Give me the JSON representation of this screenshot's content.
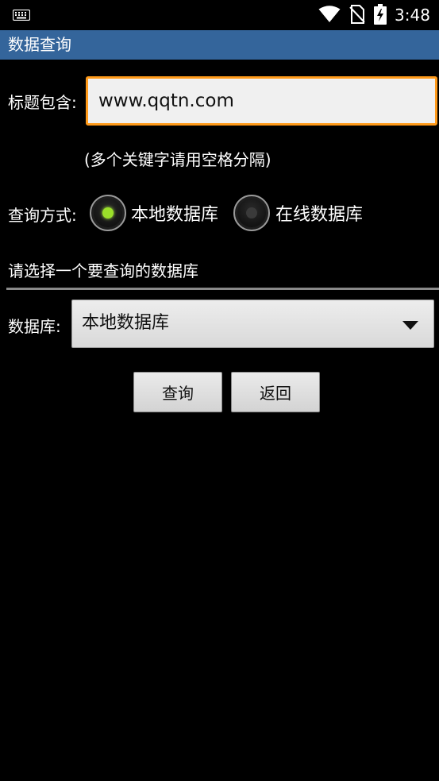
{
  "status_bar": {
    "time": "3:48",
    "icons": [
      "keyboard-icon",
      "wifi-icon",
      "no-sim-icon",
      "battery-charging-icon"
    ]
  },
  "app": {
    "title": "数据查询"
  },
  "form": {
    "title_label": "标题包含:",
    "title_value": "www.qqtn.com",
    "hint": "(多个关键字请用空格分隔)",
    "mode_label": "查询方式:",
    "mode_options": [
      {
        "label": "本地数据库",
        "checked": true
      },
      {
        "label": "在线数据库",
        "checked": false
      }
    ],
    "section_header": "请选择一个要查询的数据库",
    "db_label": "数据库:",
    "db_selected": "本地数据库"
  },
  "buttons": {
    "query": "查询",
    "back": "返回"
  },
  "colors": {
    "title_bar": "#34659b",
    "focus_border": "#ff9a1a",
    "radio_checked": "#9be02a",
    "background": "#000000"
  }
}
